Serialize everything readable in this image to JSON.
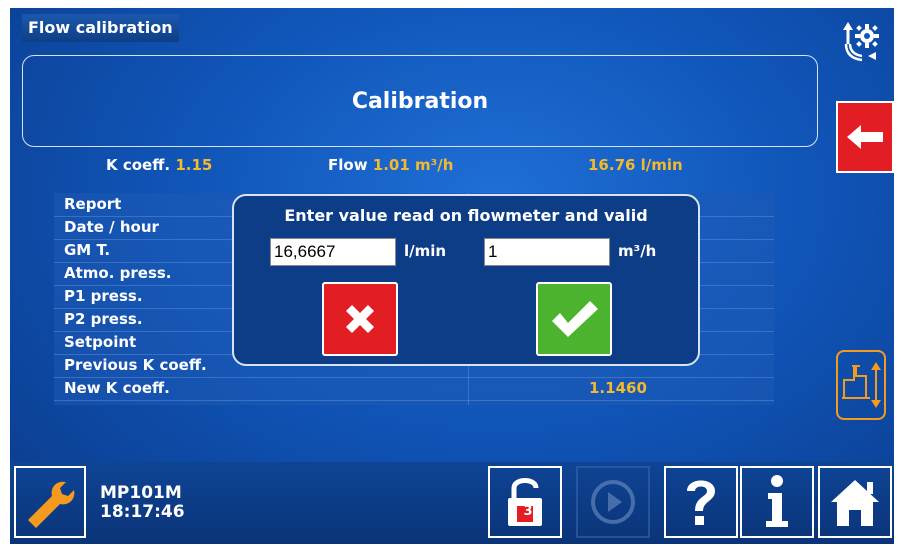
{
  "window": {
    "title": "Flow calibration"
  },
  "banner": {
    "title": "Calibration"
  },
  "status": {
    "k_coeff_label": "K coeff.",
    "k_coeff_value": "1.15",
    "flow_label": "Flow",
    "flow_value": "1.01 m³/h",
    "flow_lmin": "16.76 l/min"
  },
  "table": {
    "rows": [
      {
        "label": "Report",
        "value": ""
      },
      {
        "label": "Date / hour",
        "value": ""
      },
      {
        "label": "GM T.",
        "value": ""
      },
      {
        "label": "Atmo. press.",
        "value": ""
      },
      {
        "label": "P1 press.",
        "value": ""
      },
      {
        "label": "P2 press.",
        "value": ""
      },
      {
        "label": "Setpoint",
        "value": ""
      },
      {
        "label": "Previous K coeff.",
        "value": ""
      },
      {
        "label": "New K coeff.",
        "value": "1.1460"
      }
    ]
  },
  "dialog": {
    "title": "Enter value read on flowmeter and valid",
    "lmin_value": "16,6667",
    "lmin_unit": "l/min",
    "m3h_value": "1",
    "m3h_unit": "m³/h"
  },
  "bottom": {
    "device": "MP101M",
    "time": "18:17:46",
    "lock_badge": "3"
  },
  "colors": {
    "accent": "#f5b92e",
    "danger": "#e31d24",
    "success": "#4bb32e",
    "side_icon": "#f39a1f"
  },
  "icons": [
    "settings-gear-icon",
    "back-arrow-icon",
    "wrench-icon",
    "unlock-icon",
    "play-icon",
    "help-icon",
    "info-icon",
    "home-icon",
    "valve-icon",
    "close-icon",
    "check-icon"
  ]
}
